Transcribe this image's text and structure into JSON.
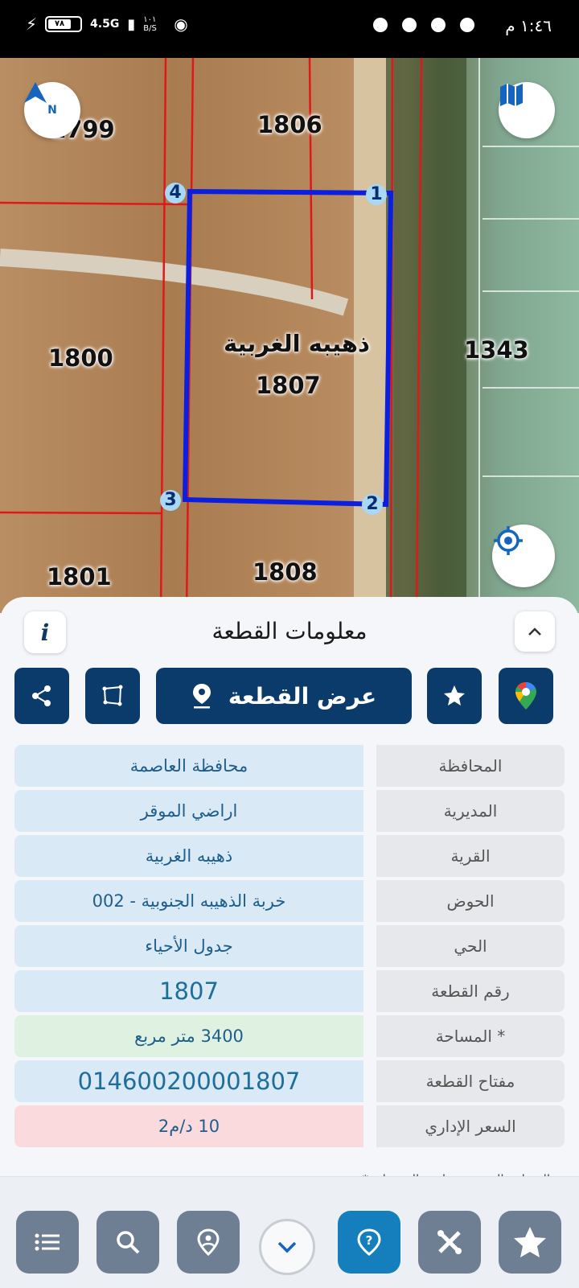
{
  "status_bar": {
    "time": "١:٤٦ م",
    "network": "4.5G",
    "battery": "٧٨",
    "data_speed": "١٠١ B/S"
  },
  "map": {
    "parcel_labels": {
      "p1799": "1799",
      "p1806": "1806",
      "p1800": "1800",
      "p1343": "1343",
      "p1801": "1801",
      "p1808": "1808"
    },
    "selected_parcel": {
      "village": "ذهيبه الغربية",
      "number": "1807"
    },
    "vertices": [
      "1",
      "2",
      "3",
      "4"
    ],
    "north_label": "N"
  },
  "panel": {
    "title": "معلومات القطعة",
    "info_icon_label": "i",
    "show_parcel_label": "عرض القطعة",
    "rows": [
      {
        "label": "المحافظة",
        "value": "محافظة العاصمة"
      },
      {
        "label": "المديرية",
        "value": "اراضي الموقر"
      },
      {
        "label": "القرية",
        "value": "ذهيبه الغربية"
      },
      {
        "label": "الحوض",
        "value": "خربة الذهيبه الجنوبية - 002"
      },
      {
        "label": "الحي",
        "value": "جدول الأحياء"
      },
      {
        "label": "رقم القطعة",
        "value": "1807"
      },
      {
        "label": "المساحة *",
        "value": "3400  متر مربع"
      },
      {
        "label": "مفتاح القطعة",
        "value": "014600200001807"
      },
      {
        "label": "السعر الإداري",
        "value": "10 د/م2"
      }
    ],
    "footnote": "* المساحة المحسوبة وليس التسجيلية"
  },
  "colors": {
    "primary": "#0b3b6b",
    "accent": "#157fbd",
    "parcel_outline": "#0a1fe0",
    "boundary": "#e01818"
  },
  "icons": {
    "bottom_bar": [
      "list-icon",
      "search-icon",
      "location-pin-icon",
      "chevron-down-icon",
      "help-icon",
      "tools-icon",
      "star-icon"
    ]
  }
}
